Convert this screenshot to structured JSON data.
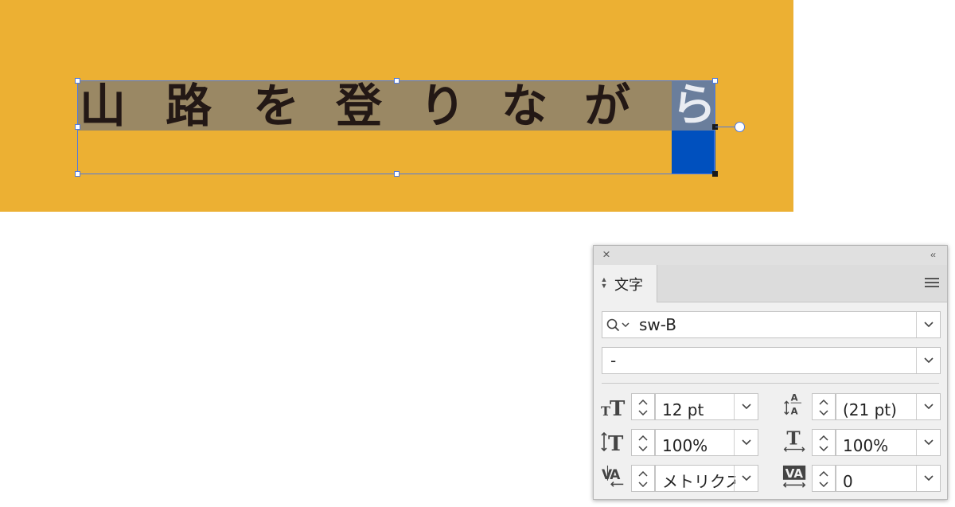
{
  "canvas": {
    "text_glyphs": [
      "山",
      "路",
      "を",
      "登",
      "り",
      "な",
      "が"
    ],
    "selected_glyph": "ら",
    "colors": {
      "artboard": "#ecb033",
      "text_highlight": "#9a8864",
      "selection": "#0050be",
      "guide": "#4f7ae0",
      "text": "#231815"
    }
  },
  "panel": {
    "close_icon": "×",
    "collapse_icon": "‹‹",
    "tab_label": "文字",
    "font_search": {
      "search_icon": "search-icon",
      "value": "sw-B"
    },
    "font_style": {
      "value": "-"
    },
    "rows": [
      {
        "left": {
          "icon": "font-size-icon",
          "value": "12 pt"
        },
        "right": {
          "icon": "leading-icon",
          "value": "(21 pt)"
        }
      },
      {
        "left": {
          "icon": "vertical-scale-icon",
          "value": "100%"
        },
        "right": {
          "icon": "horizontal-scale-icon",
          "value": "100%"
        }
      },
      {
        "left": {
          "icon": "kerning-icon",
          "value": "メトリクス"
        },
        "right": {
          "icon": "tracking-icon",
          "value": "0"
        }
      }
    ]
  }
}
